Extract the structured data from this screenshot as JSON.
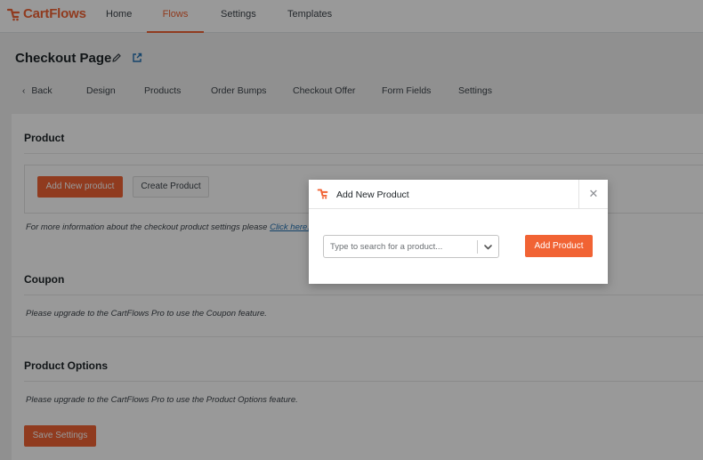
{
  "brand": {
    "name": "CartFlows",
    "color": "#f16334"
  },
  "topnav": {
    "items": [
      {
        "label": "Home",
        "active": false
      },
      {
        "label": "Flows",
        "active": true
      },
      {
        "label": "Settings",
        "active": false
      },
      {
        "label": "Templates",
        "active": false
      }
    ]
  },
  "page": {
    "title": "Checkout Page",
    "edit_icon": "pencil-icon",
    "view_icon": "external-link-icon"
  },
  "subtabs": {
    "back_label": "Back",
    "items": [
      "Design",
      "Products",
      "Order Bumps",
      "Checkout Offer",
      "Form Fields",
      "Settings"
    ]
  },
  "product_section": {
    "title": "Product",
    "add_button": "Add New product",
    "create_button": "Create Product",
    "note_prefix": "For more information about the checkout product settings please",
    "note_link": "Click here."
  },
  "coupon_section": {
    "title": "Coupon",
    "note": "Please upgrade to the CartFlows Pro to use the Coupon feature."
  },
  "product_options_section": {
    "title": "Product Options",
    "note": "Please upgrade to the CartFlows Pro to use the Product Options feature."
  },
  "save_button": "Save Settings",
  "modal": {
    "title": "Add New Product",
    "close_icon": "close-icon",
    "search_placeholder": "Type to search for a product...",
    "add_button": "Add Product"
  }
}
